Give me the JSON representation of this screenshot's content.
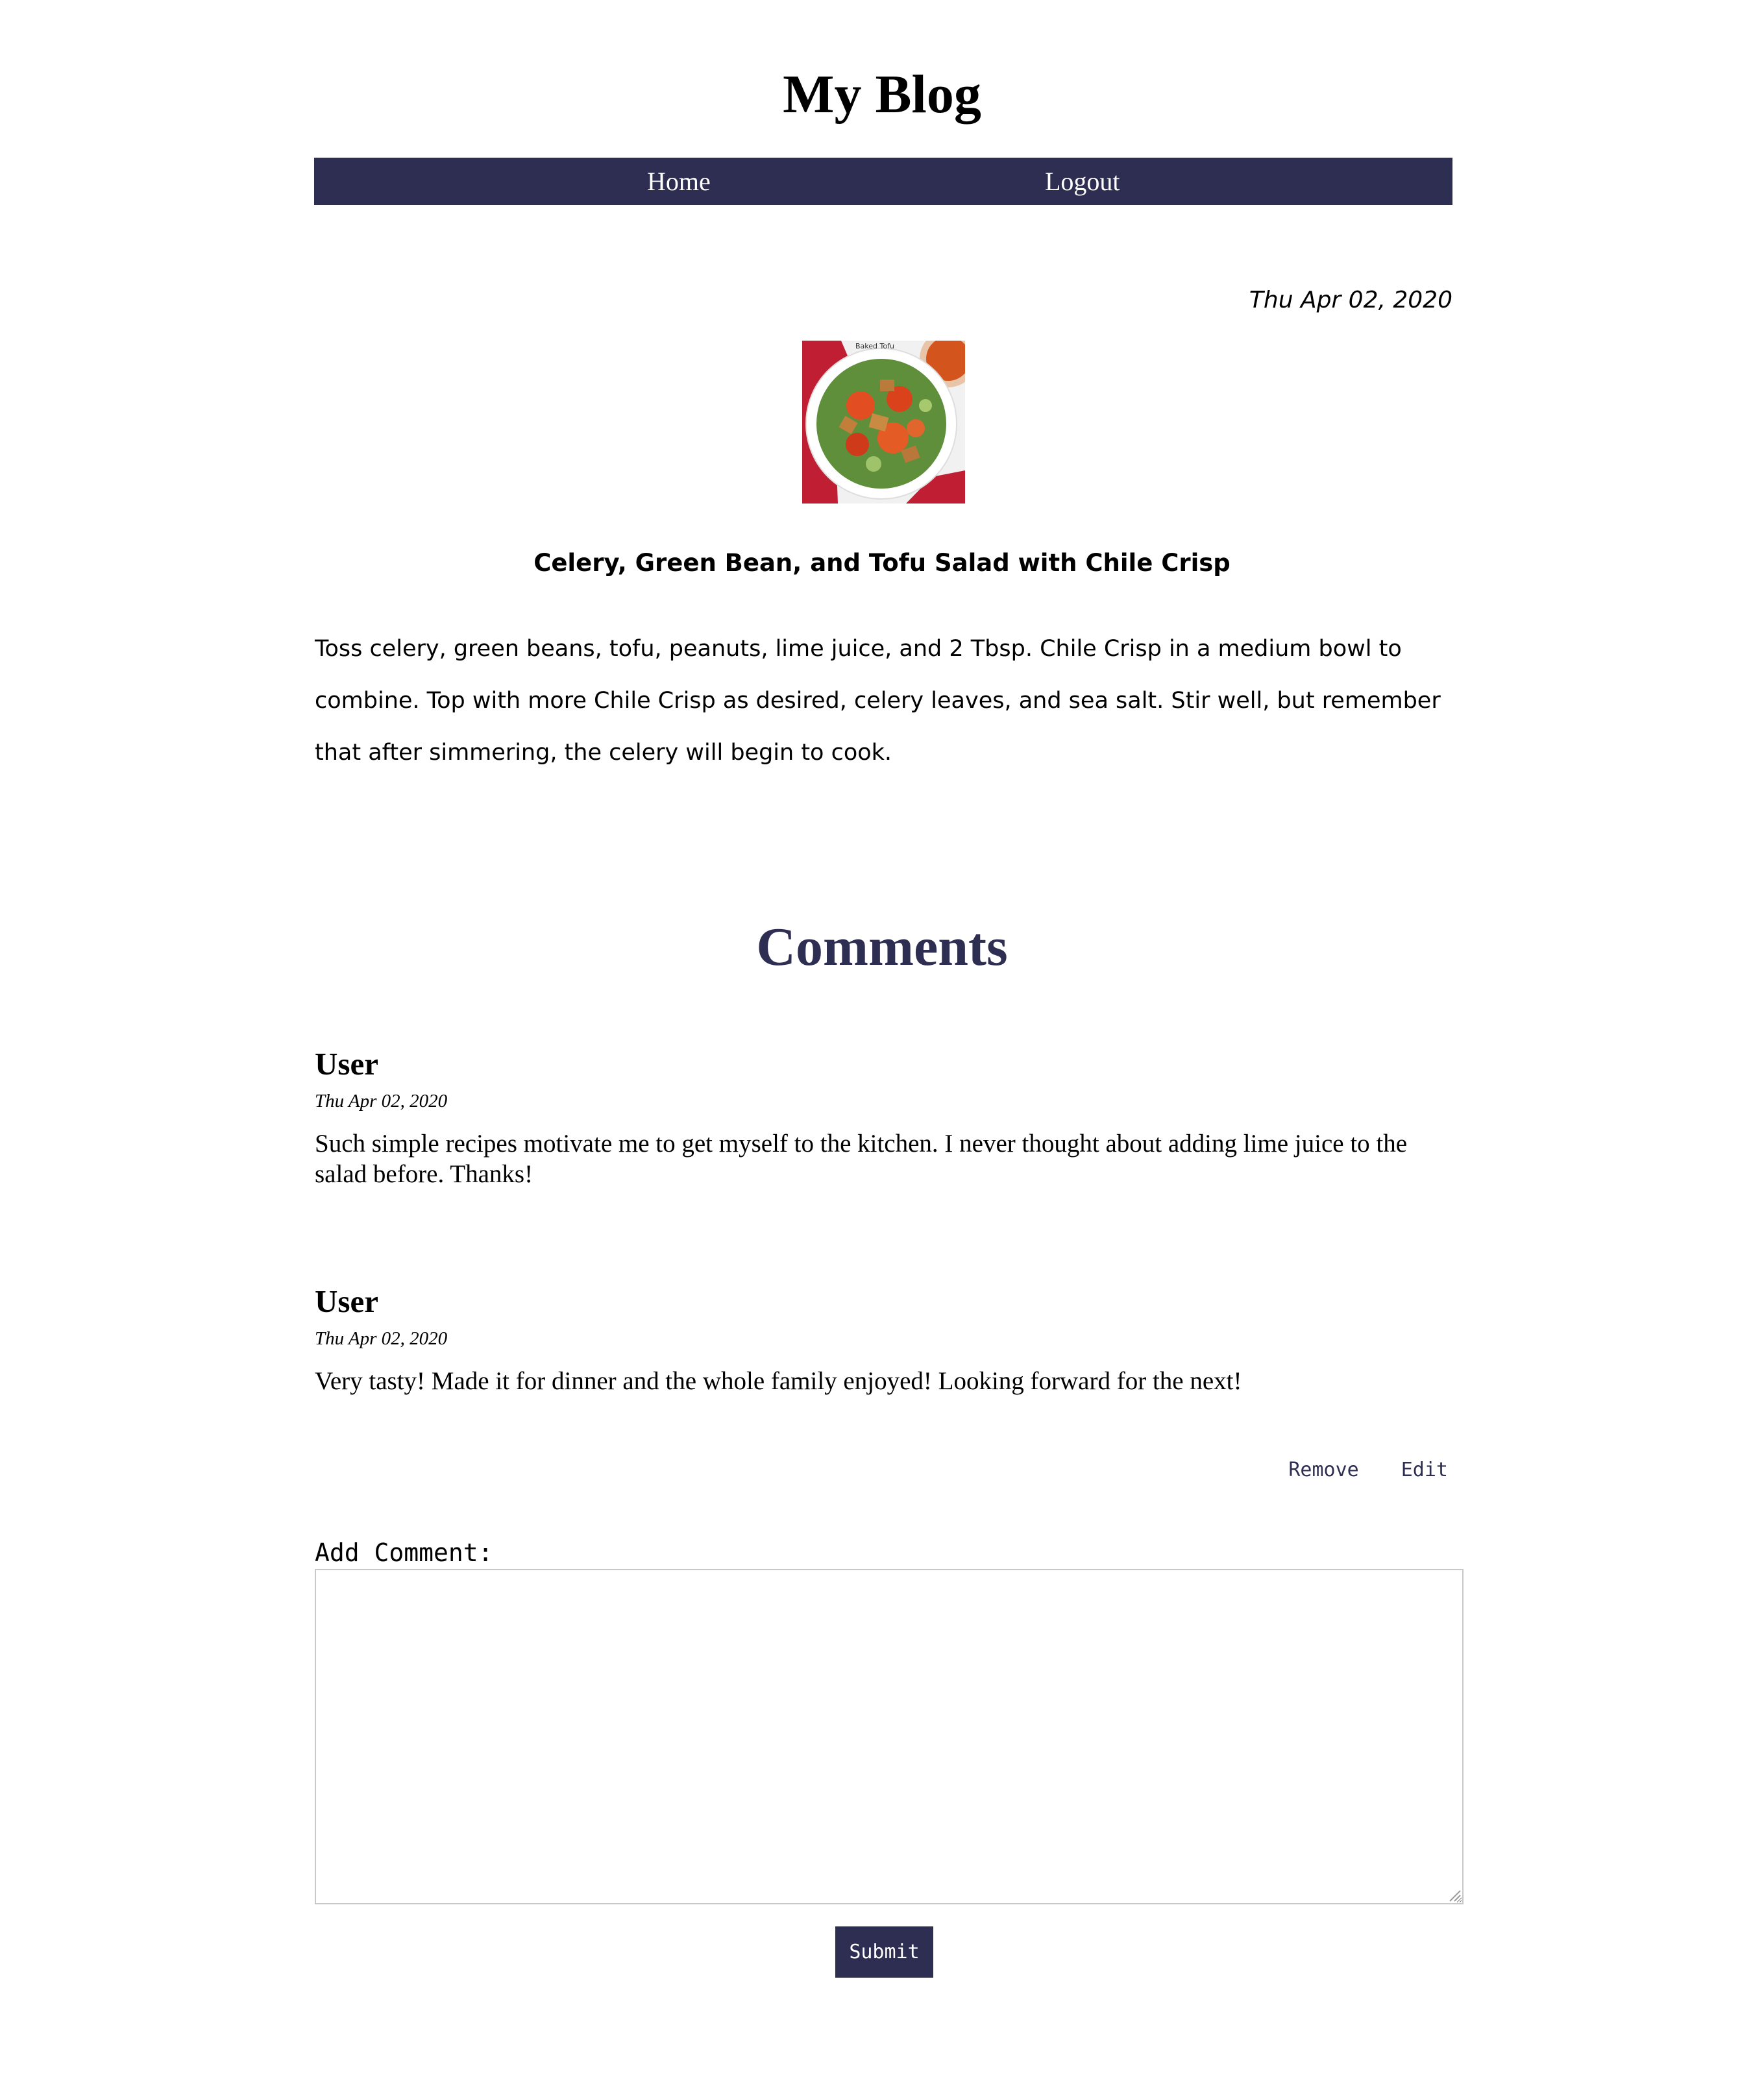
{
  "header": {
    "site_title": "My Blog",
    "nav": {
      "home": "Home",
      "logout": "Logout"
    }
  },
  "post": {
    "date": "Thu Apr 02, 2020",
    "image_caption": "Baked Tofu",
    "title": "Celery, Green Bean, and Tofu Salad with Chile Crisp",
    "body": "Toss celery, green beans, tofu, peanuts, lime juice, and 2 Tbsp. Chile Crisp in a medium bowl to combine. Top with more Chile Crisp as desired, celery leaves, and sea salt.  Stir well, but remember that after simmering, the celery will begin to cook."
  },
  "comments": {
    "heading": "Comments",
    "items": [
      {
        "author": "User",
        "date": "Thu Apr 02, 2020",
        "text": "Such simple recipes motivate me to get myself to the kitchen. I never thought about adding lime juice to the salad before. Thanks!"
      },
      {
        "author": "User",
        "date": "Thu Apr 02, 2020",
        "text": "Very tasty! Made it for dinner and the whole family enjoyed! Looking forward for the next!"
      }
    ],
    "actions": {
      "remove": "Remove",
      "edit": "Edit"
    }
  },
  "form": {
    "label": "Add Comment:",
    "textarea_value": "",
    "submit_label": "Submit"
  },
  "colors": {
    "accent": "#2e2e52",
    "background": "#ffffff",
    "text": "#000000"
  },
  "icons": {
    "resize": "resize-grip-icon"
  }
}
